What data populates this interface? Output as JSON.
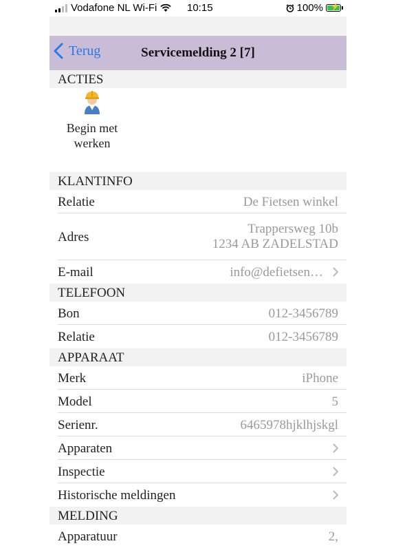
{
  "status": {
    "carrier": "Vodafone NL Wi-Fi",
    "time": "10:15",
    "battery": "100%"
  },
  "nav": {
    "back_label": "Terug",
    "title": "Servicemelding 2 [7]"
  },
  "colors": {
    "navbar": "#c8bcd6",
    "accent": "#2a78e4",
    "section_bg": "#f2f2f2"
  },
  "sections": {
    "acties": "ACTIES",
    "klantinfo": "KLANTINFO",
    "telefoon": "TELEFOON",
    "apparaat": "APPARAAT",
    "melding": "MELDING"
  },
  "actions": [
    {
      "icon": "worker-icon",
      "label_line1": "Begin met",
      "label_line2": "werken"
    }
  ],
  "klantinfo": {
    "relatie": {
      "label": "Relatie",
      "value": "De Fietsen winkel"
    },
    "adres": {
      "label": "Adres",
      "line1": "Trappersweg 10b",
      "line2": "1234 AB ZADELSTAD"
    },
    "email": {
      "label": "E-mail",
      "value": "info@defietsen…"
    }
  },
  "telefoon": {
    "bon": {
      "label": "Bon",
      "value": "012-3456789"
    },
    "relatie": {
      "label": "Relatie",
      "value": "012-3456789"
    }
  },
  "apparaat": {
    "merk": {
      "label": "Merk",
      "value": "iPhone"
    },
    "model": {
      "label": "Model",
      "value": "5"
    },
    "serienr": {
      "label": "Serienr.",
      "value": "6465978hjklhjskgl"
    },
    "apparaten": {
      "label": "Apparaten"
    },
    "inspectie": {
      "label": "Inspectie"
    },
    "historische": {
      "label": "Historische meldingen"
    }
  },
  "melding": {
    "apparatuur": {
      "label": "Apparatuur",
      "value": "2,"
    }
  }
}
